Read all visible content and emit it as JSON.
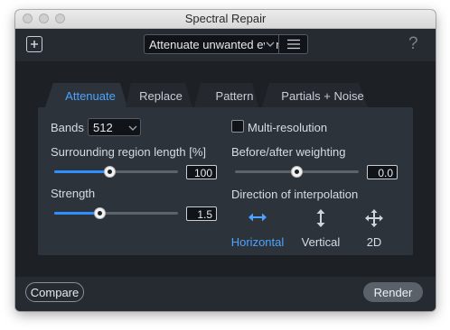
{
  "window": {
    "title": "Spectral Repair"
  },
  "toolbar": {
    "preset_value": "Attenuate unwanted events",
    "help_label": "?"
  },
  "tabs": [
    {
      "label": "Attenuate",
      "active": true
    },
    {
      "label": "Replace",
      "active": false
    },
    {
      "label": "Pattern",
      "active": false
    },
    {
      "label": "Partials + Noise",
      "active": false
    }
  ],
  "settings": {
    "bands_label": "Bands",
    "bands_value": "512",
    "multires_label": "Multi-resolution",
    "multires_checked": false,
    "surrounding_label": "Surrounding region length [%]",
    "surrounding_value": "100",
    "surrounding_fraction": 0.45,
    "strength_label": "Strength",
    "strength_value": "1.5",
    "strength_fraction": 0.37,
    "weighting_label": "Before/after weighting",
    "weighting_value": "0.0",
    "weighting_fraction": 0.5,
    "direction_label": "Direction of interpolation",
    "directions": [
      {
        "label": "Horizontal",
        "icon": "horizontal-arrows-icon",
        "active": true
      },
      {
        "label": "Vertical",
        "icon": "vertical-arrows-icon",
        "active": false
      },
      {
        "label": "2D",
        "icon": "four-way-arrows-icon",
        "active": false
      }
    ]
  },
  "footer": {
    "compare_label": "Compare",
    "render_label": "Render"
  },
  "colors": {
    "accent": "#2e8fff",
    "active_text": "#4da3ff",
    "background": "#1d2126",
    "panel": "#2d333b"
  }
}
